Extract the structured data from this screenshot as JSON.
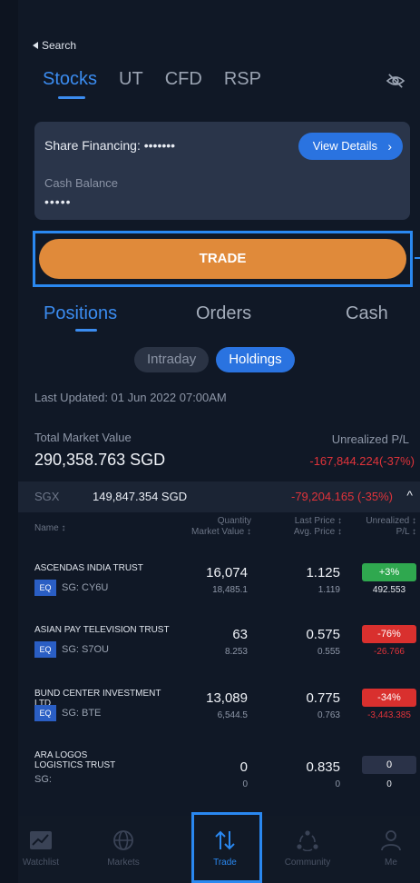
{
  "header": {
    "back_label": "Search"
  },
  "asset_tabs": [
    "Stocks",
    "UT",
    "CFD",
    "RSP"
  ],
  "active_asset_tab": "Stocks",
  "account_card": {
    "share_financing_label": "Share Financing:",
    "share_financing_value": "•••••••",
    "view_details_label": "View Details",
    "cash_balance_label": "Cash Balance",
    "cash_balance_value": "•••••"
  },
  "trade_button_label": "TRADE",
  "section_tabs": [
    "Positions",
    "Orders",
    "Cash"
  ],
  "active_section_tab": "Positions",
  "holding_filters": [
    "Intraday",
    "Holdings"
  ],
  "active_holding_filter": "Holdings",
  "last_updated": "Last Updated: 01 Jun 2022 07:00AM",
  "summary": {
    "total_market_value_label": "Total Market Value",
    "total_market_value": "290,358.763 SGD",
    "unrealized_label": "Unrealized P/L",
    "unrealized_value": "-167,844.224(-37%)"
  },
  "exchange": {
    "name": "SGX",
    "amount": "149,847.354 SGD",
    "pl": "-79,204.165 (-35%)"
  },
  "table_headers": {
    "name": "Name ↕",
    "quantity": "Quantity",
    "market_value": "Market Value ↕",
    "last_price": "Last Price ↕",
    "avg_price": "Avg. Price ↕",
    "unrealized": "Unrealized ↕",
    "pl": "P/L ↕"
  },
  "positions": [
    {
      "name": "ASCENDAS INDIA TRUST",
      "type": "EQ",
      "code": "SG: CY6U",
      "quantity": "16,074",
      "market_value": "18,485.1",
      "last_price": "1.125",
      "avg_price": "1.119",
      "pct": "+3%",
      "pct_style": "g",
      "unrealized": "492.553",
      "unrealized_color": "#e6e9ef"
    },
    {
      "name": "ASIAN PAY TELEVISION TRUST",
      "type": "EQ",
      "code": "SG: S7OU",
      "quantity": "63",
      "market_value": "8.253",
      "last_price": "0.575",
      "avg_price": "0.555",
      "pct": "-76%",
      "pct_style": "r",
      "unrealized": "-26.766",
      "unrealized_color": "#e0333a"
    },
    {
      "name": "BUND CENTER INVESTMENT LTD",
      "type": "EQ",
      "code": "SG: BTE",
      "quantity": "13,089",
      "market_value": "6,544.5",
      "last_price": "0.775",
      "avg_price": "0.763",
      "pct": "-34%",
      "pct_style": "r",
      "unrealized": "-3,443.385",
      "unrealized_color": "#e0333a"
    },
    {
      "name": "ARA LOGOS LOGISTICS TRUST",
      "type": "",
      "code": "SG:",
      "quantity": "0",
      "market_value": "0",
      "last_price": "0.835",
      "avg_price": "0",
      "pct": "0",
      "pct_style": "n",
      "unrealized": "0",
      "unrealized_color": "#e6e9ef"
    }
  ],
  "bottom_nav": [
    {
      "label": "Watchlist",
      "icon": "chart-icon"
    },
    {
      "label": "Markets",
      "icon": "globe-icon"
    },
    {
      "label": "Trade",
      "icon": "swap-icon"
    },
    {
      "label": "Community",
      "icon": "community-icon"
    },
    {
      "label": "Me",
      "icon": "person-icon"
    }
  ],
  "active_nav": "Trade"
}
